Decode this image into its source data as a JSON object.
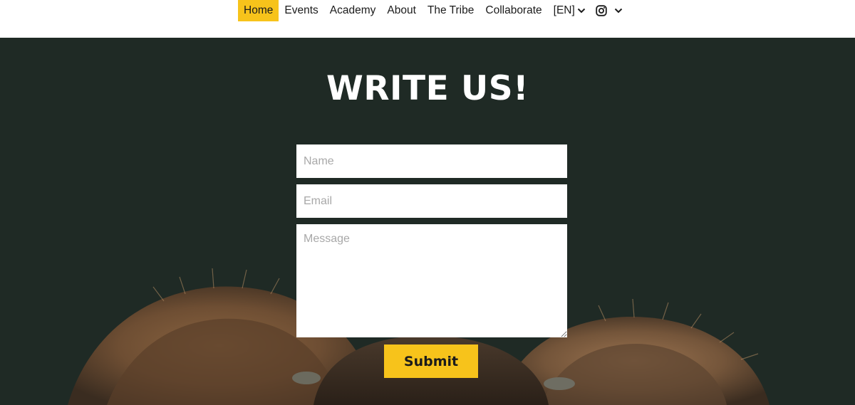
{
  "nav": {
    "items": [
      {
        "label": "Home",
        "active": true
      },
      {
        "label": "Events"
      },
      {
        "label": "Academy"
      },
      {
        "label": "About"
      },
      {
        "label": "The Tribe"
      },
      {
        "label": "Collaborate"
      }
    ],
    "language": "[EN]",
    "language_icon": "chevron-down-icon",
    "social_icon": "instagram-icon",
    "more_icon": "chevron-down-icon"
  },
  "contact": {
    "title": "WRITE US!",
    "name_placeholder": "Name",
    "email_placeholder": "Email",
    "message_placeholder": "Message",
    "submit_label": "Submit"
  },
  "colors": {
    "accent": "#f7c31b",
    "hero_background": "#1f2a25",
    "text_dark": "#1b1b1b",
    "placeholder": "#a8a8a8"
  }
}
